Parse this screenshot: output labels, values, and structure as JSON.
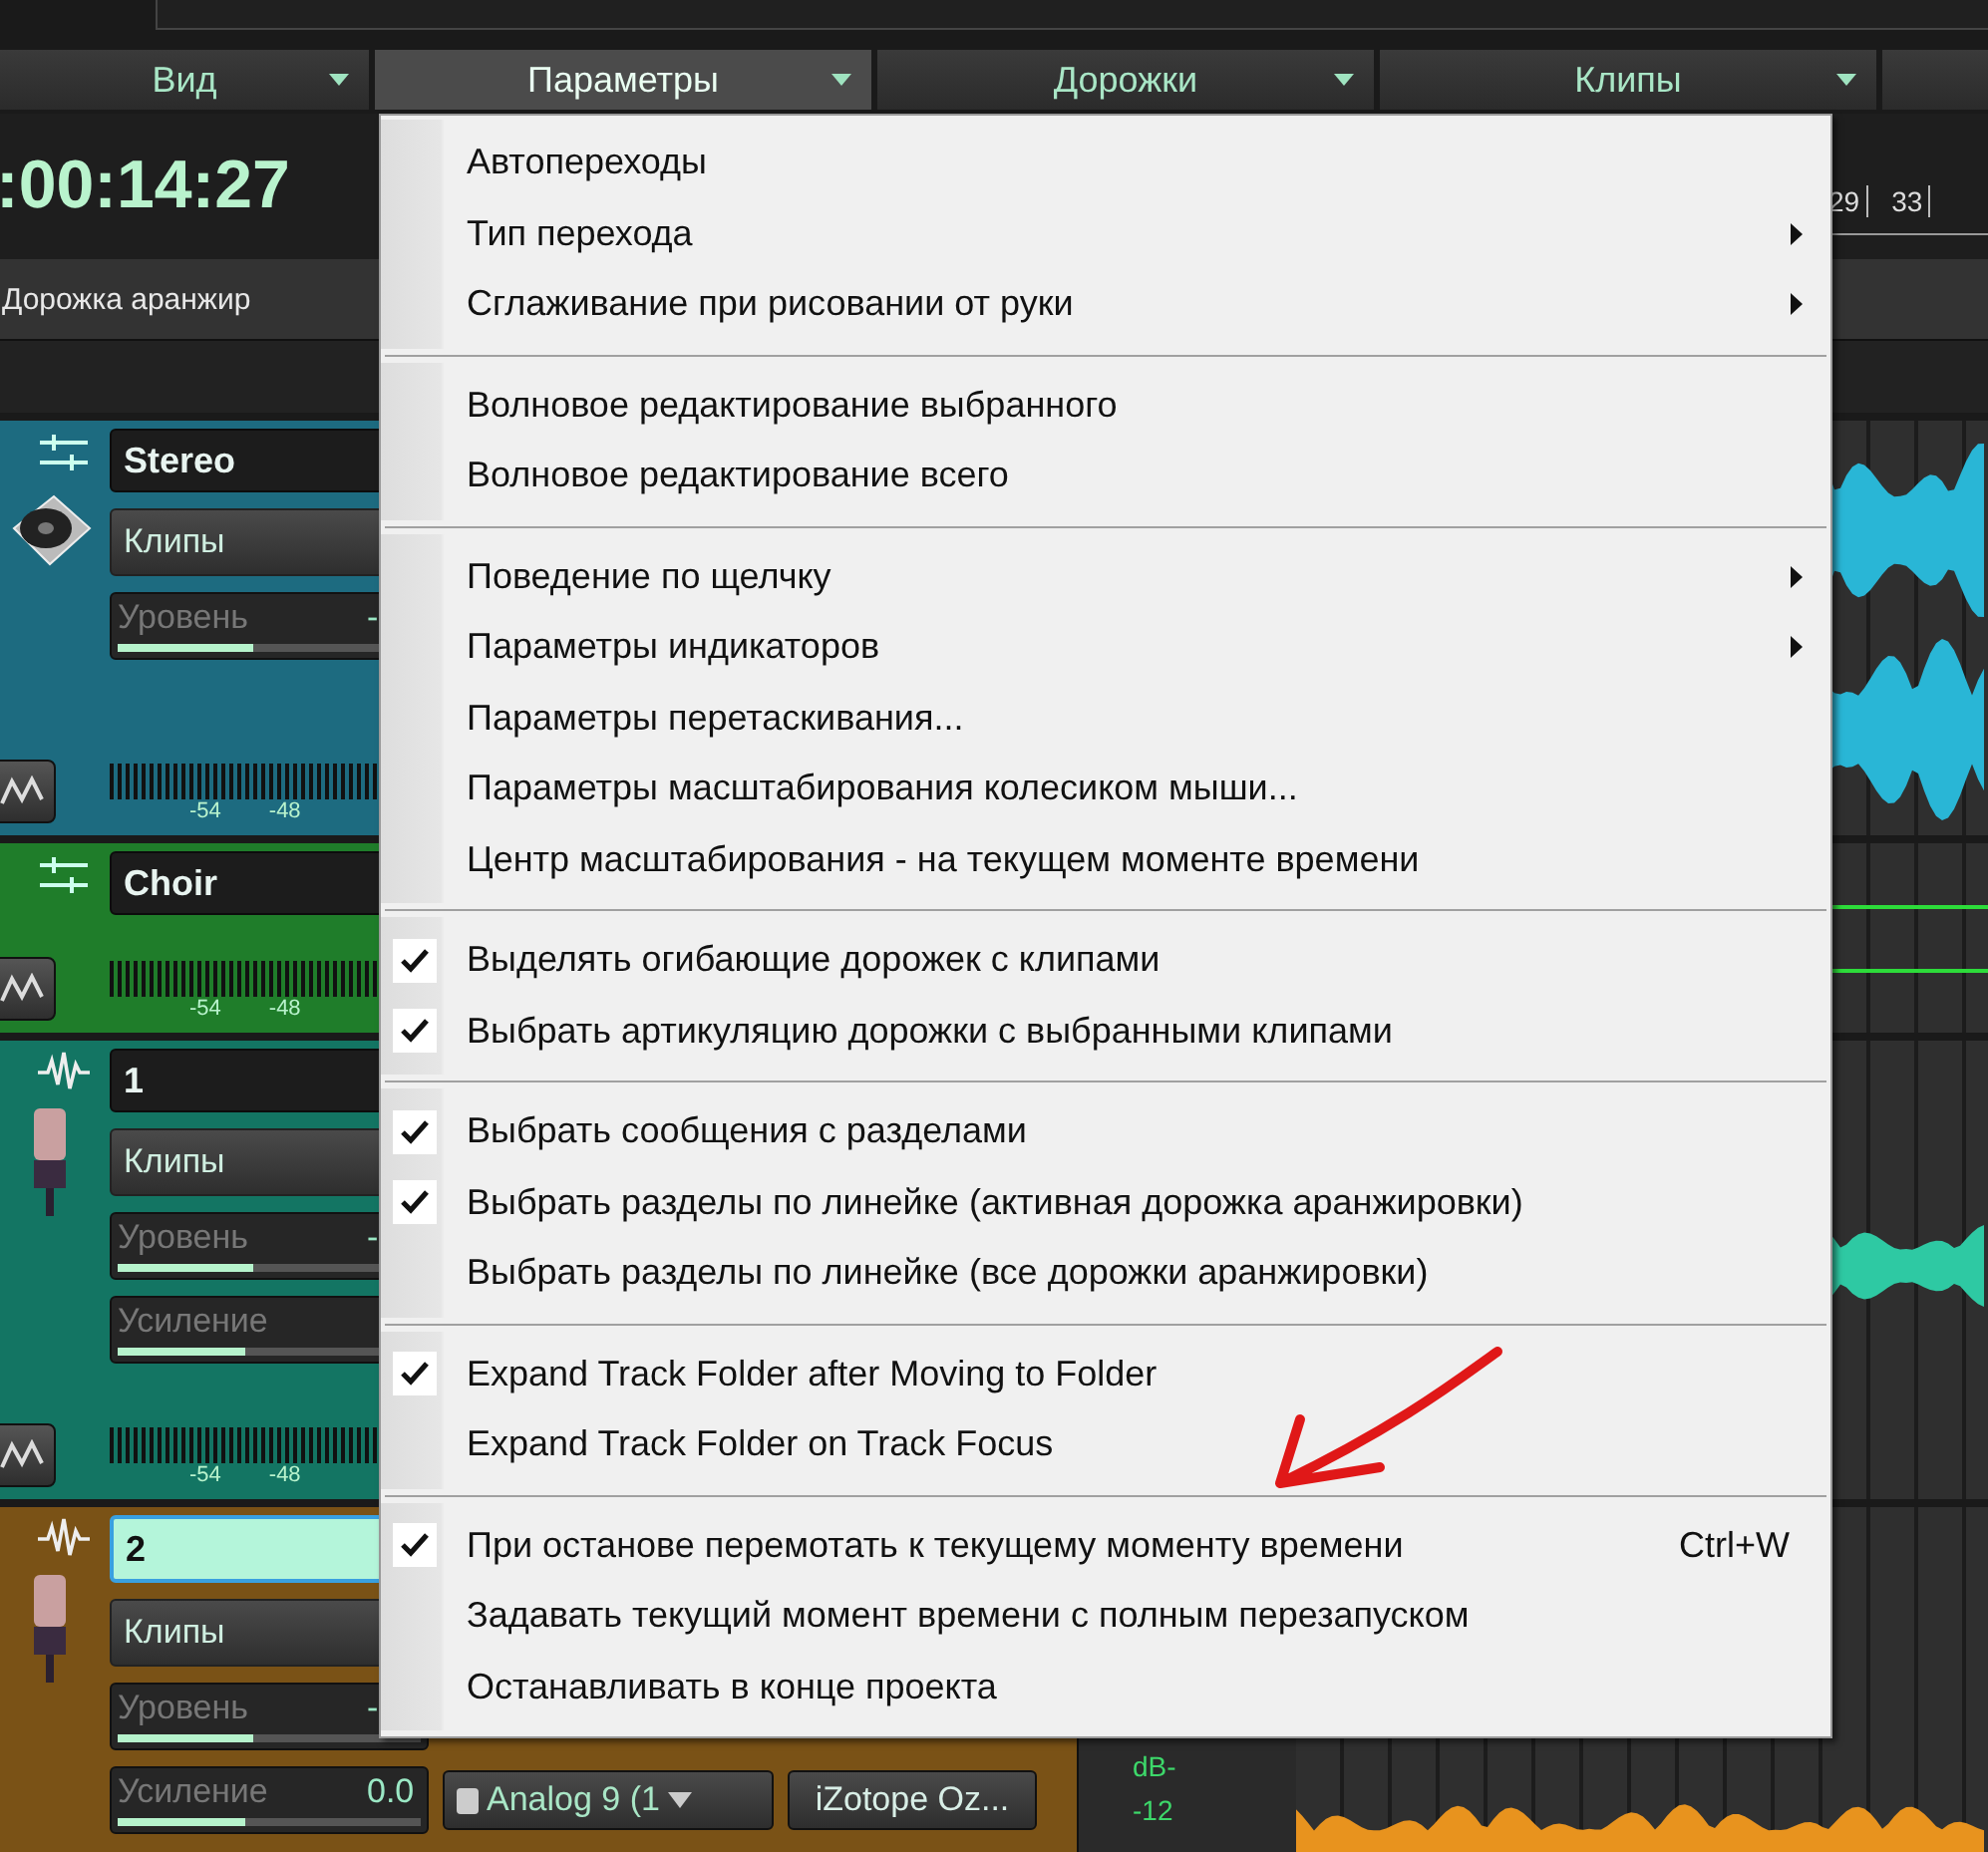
{
  "menubar": [
    {
      "label": "Вид",
      "selected": false
    },
    {
      "label": "Параметры",
      "selected": true
    },
    {
      "label": "Дорожки",
      "selected": false
    },
    {
      "label": "Клипы",
      "selected": false
    }
  ],
  "time": ":00:14:27",
  "ruler": [
    "29",
    "33"
  ],
  "arranger_track": "Дорожка аранжир",
  "tracks": [
    {
      "name": "Stereo",
      "kind": "bus",
      "color": "#1d6b80",
      "selected": false,
      "expanded": true,
      "clips": "Клипы",
      "sliders": [
        {
          "label": "Уровень",
          "value": "-",
          "level": 0.45
        }
      ],
      "meter_scale": [
        "-54",
        "-48"
      ]
    },
    {
      "name": "Choir",
      "kind": "bus",
      "color": "#1f7d2a",
      "selected": false,
      "expanded": false,
      "meter_scale": [
        "-54",
        "-48"
      ]
    },
    {
      "name": "1",
      "kind": "audio",
      "color": "#137563",
      "selected": false,
      "expanded": true,
      "clips": "Клипы",
      "sliders": [
        {
          "label": "Уровень",
          "value": "-",
          "level": 0.45
        },
        {
          "label": "Усиление",
          "level": 0.42
        }
      ],
      "meter_scale": [
        "-54",
        "-48"
      ]
    },
    {
      "name": "2",
      "kind": "audio",
      "color": "#7a5216",
      "selected": true,
      "expanded": true,
      "clips": "Клипы",
      "sliders": [
        {
          "label": "Уровень",
          "value": "-",
          "level": 0.45
        },
        {
          "label": "Усиление",
          "value": "0.0",
          "level": 0.42
        }
      ],
      "plugin_slot": "Analog 9 (1",
      "effect_button": "iZotope Oz...",
      "db_scale": [
        "dB-",
        "-12"
      ]
    }
  ],
  "menu": [
    {
      "items": [
        {
          "label": "Автопереходы",
          "checked": false,
          "submenu": false
        },
        {
          "label": "Тип перехода",
          "checked": false,
          "submenu": true
        },
        {
          "label": "Сглаживание при рисовании от руки",
          "checked": false,
          "submenu": true
        }
      ]
    },
    {
      "items": [
        {
          "label": "Волновое редактирование выбранного",
          "checked": false,
          "submenu": false
        },
        {
          "label": "Волновое редактирование всего",
          "checked": false,
          "submenu": false
        }
      ]
    },
    {
      "items": [
        {
          "label": "Поведение по щелчку",
          "checked": false,
          "submenu": true
        },
        {
          "label": "Параметры индикаторов",
          "checked": false,
          "submenu": true
        },
        {
          "label": "Параметры перетаскивания...",
          "checked": false,
          "submenu": false
        },
        {
          "label": "Параметры масштабирования колесиком мыши...",
          "checked": false,
          "submenu": false
        },
        {
          "label": "Центр масштабирования - на текущем моменте времени",
          "checked": false,
          "submenu": false
        }
      ]
    },
    {
      "items": [
        {
          "label": "Выделять огибающие дорожек с клипами",
          "checked": true,
          "submenu": false
        },
        {
          "label": "Выбрать артикуляцию дорожки с выбранными клипами",
          "checked": true,
          "submenu": false
        }
      ]
    },
    {
      "items": [
        {
          "label": "Выбрать сообщения с разделами",
          "checked": true,
          "submenu": false
        },
        {
          "label": "Выбрать разделы по линейке (активная дорожка аранжировки)",
          "checked": true,
          "submenu": false
        },
        {
          "label": "Выбрать разделы по линейке (все дорожки аранжировки)",
          "checked": false,
          "submenu": false
        }
      ]
    },
    {
      "items": [
        {
          "label": "Expand Track Folder after Moving to Folder",
          "checked": true,
          "submenu": false
        },
        {
          "label": "Expand Track Folder on Track Focus",
          "checked": false,
          "submenu": false
        }
      ]
    },
    {
      "items": [
        {
          "label": "При останове перемотать к текущему моменту времени",
          "checked": true,
          "submenu": false,
          "shortcut": "Ctrl+W"
        },
        {
          "label": "Задавать текущий момент времени с полным перезапуском",
          "checked": false,
          "submenu": false
        },
        {
          "label": "Останавливать в конце проекта",
          "checked": false,
          "submenu": false
        }
      ]
    }
  ]
}
